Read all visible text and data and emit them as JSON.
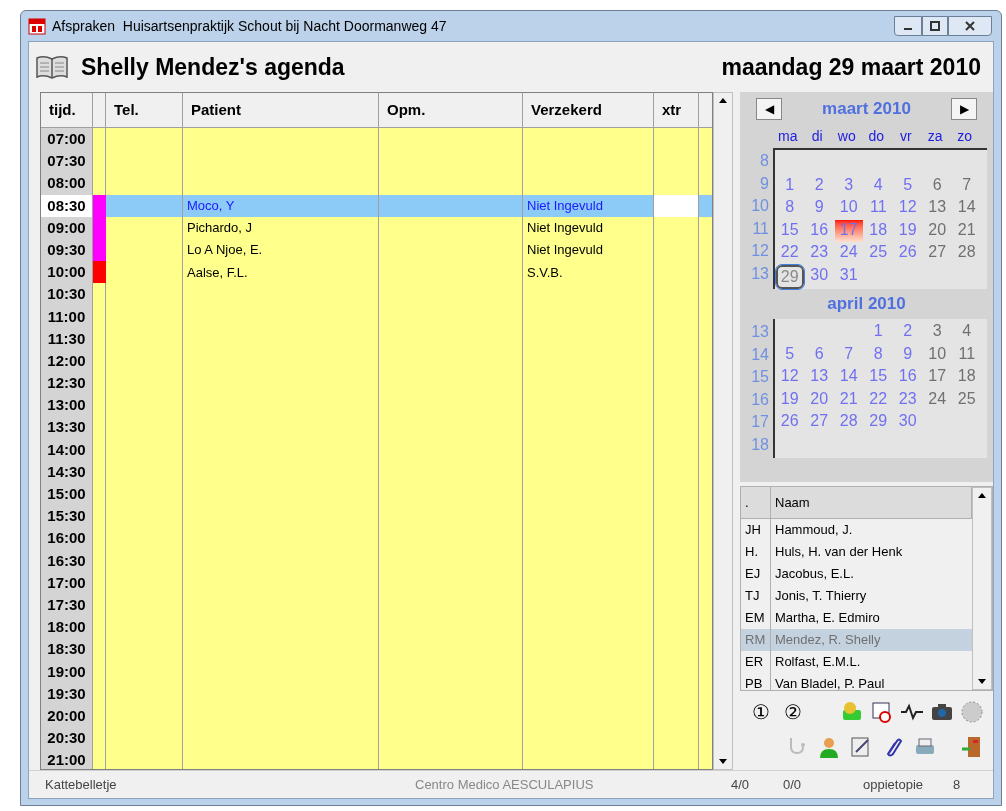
{
  "window": {
    "title": "Afspraken  Huisartsenpraktijk Schout bij Nacht Doormanweg 47"
  },
  "header": {
    "agenda_title": "Shelly Mendez's agenda",
    "date": "maandag 29 maart 2010"
  },
  "table": {
    "columns": [
      "tijd.",
      "Tel.",
      "Patient",
      "Opm.",
      "Verzekerd",
      "xtr"
    ],
    "rows": [
      {
        "time": "07:00",
        "selected": false
      },
      {
        "time": "07:30",
        "selected": false
      },
      {
        "time": "08:00",
        "selected": false
      },
      {
        "time": "08:30",
        "selected": true,
        "color": "#ff00ff",
        "patient": "Moco,  Y",
        "insured": "Niet Ingevuld"
      },
      {
        "time": "09:00",
        "selected": false,
        "color": "#ff00ff",
        "patient": "Pichardo,  J",
        "insured": "Niet Ingevuld"
      },
      {
        "time": "09:30",
        "selected": false,
        "color": "#ff00ff",
        "patient": "Lo A Njoe,  E.",
        "insured": "Niet Ingevuld"
      },
      {
        "time": "10:00",
        "selected": false,
        "color": "#ff0000",
        "patient": "Aalse,  F.L.",
        "insured": "S.V.B."
      },
      {
        "time": "10:30",
        "selected": false
      },
      {
        "time": "11:00",
        "selected": false
      },
      {
        "time": "11:30",
        "selected": false
      },
      {
        "time": "12:00",
        "selected": false
      },
      {
        "time": "12:30",
        "selected": false
      },
      {
        "time": "13:00",
        "selected": false
      },
      {
        "time": "13:30",
        "selected": false
      },
      {
        "time": "14:00",
        "selected": false
      },
      {
        "time": "14:30",
        "selected": false
      },
      {
        "time": "15:00",
        "selected": false
      },
      {
        "time": "15:30",
        "selected": false
      },
      {
        "time": "16:00",
        "selected": false
      },
      {
        "time": "16:30",
        "selected": false
      },
      {
        "time": "17:00",
        "selected": false
      },
      {
        "time": "17:30",
        "selected": false
      },
      {
        "time": "18:00",
        "selected": false
      },
      {
        "time": "18:30",
        "selected": false
      },
      {
        "time": "19:00",
        "selected": false
      },
      {
        "time": "19:30",
        "selected": false
      },
      {
        "time": "20:00",
        "selected": false
      },
      {
        "time": "20:30",
        "selected": false
      },
      {
        "time": "21:00",
        "selected": false
      }
    ]
  },
  "calendar": {
    "prev": "◀",
    "next": "▶",
    "weekdays": [
      "ma",
      "di",
      "wo",
      "do",
      "vr",
      "za",
      "zo"
    ],
    "months": [
      {
        "title": "maart 2010",
        "weeks": [
          {
            "week": "8",
            "kind": "left"
          },
          {
            "week": "9",
            "kind": "left",
            "days": [
              {
                "day": "1",
                "kind": "weekday",
                "selected": false
              },
              {
                "day": "2",
                "kind": "weekday",
                "selected": false
              },
              {
                "day": "3",
                "kind": "weekday",
                "selected": false
              },
              {
                "day": "4",
                "kind": "weekday",
                "selected": false
              },
              {
                "day": "5",
                "kind": "weekday",
                "selected": false
              },
              {
                "day": "6",
                "kind": "weekend",
                "selected": false
              },
              {
                "day": "7",
                "kind": "weekend",
                "selected": false
              }
            ]
          },
          {
            "week": "10",
            "kind": "left",
            "days": [
              {
                "day": "8",
                "kind": "weekday",
                "selected": false
              },
              {
                "day": "9",
                "kind": "weekday",
                "selected": false
              },
              {
                "day": "10",
                "kind": "weekday",
                "selected": false
              },
              {
                "day": "11",
                "kind": "weekday",
                "selected": false
              },
              {
                "day": "12",
                "kind": "weekday",
                "selected": false
              },
              {
                "day": "13",
                "kind": "weekend",
                "selected": false
              },
              {
                "day": "14",
                "kind": "weekend",
                "selected": false
              }
            ]
          },
          {
            "week": "11",
            "kind": "left",
            "days": [
              {
                "day": "15",
                "kind": "weekday",
                "selected": false
              },
              {
                "day": "16",
                "kind": "weekday",
                "selected": false
              },
              {
                "day": "17",
                "kind": "marked",
                "selected": false
              },
              {
                "day": "18",
                "kind": "weekday",
                "selected": false
              },
              {
                "day": "19",
                "kind": "weekday",
                "selected": false
              },
              {
                "day": "20",
                "kind": "weekend",
                "selected": false
              },
              {
                "day": "21",
                "kind": "weekend",
                "selected": false
              }
            ]
          },
          {
            "week": "12",
            "kind": "left",
            "days": [
              {
                "day": "22",
                "kind": "weekday",
                "selected": false
              },
              {
                "day": "23",
                "kind": "weekday",
                "selected": false
              },
              {
                "day": "24",
                "kind": "weekday",
                "selected": false
              },
              {
                "day": "25",
                "kind": "weekday",
                "selected": false
              },
              {
                "day": "26",
                "kind": "weekday",
                "selected": false
              },
              {
                "day": "27",
                "kind": "weekend",
                "selected": false
              },
              {
                "day": "28",
                "kind": "weekend",
                "selected": false
              }
            ]
          },
          {
            "week": "13",
            "kind": "left",
            "days": [
              {
                "day": "29",
                "kind": "weekday",
                "selected": true
              },
              {
                "day": "30",
                "kind": "weekday",
                "selected": false
              },
              {
                "day": "31",
                "kind": "weekday",
                "selected": false
              }
            ]
          }
        ]
      },
      {
        "title": "april 2010",
        "weeks": [
          {
            "week": "13",
            "kind": "right",
            "days": [
              {
                "day": "1",
                "kind": "weekday",
                "selected": false
              },
              {
                "day": "2",
                "kind": "weekday",
                "selected": false
              },
              {
                "day": "3",
                "kind": "weekend",
                "selected": false
              },
              {
                "day": "4",
                "kind": "weekend",
                "selected": false
              }
            ]
          },
          {
            "week": "14",
            "kind": "left",
            "days": [
              {
                "day": "5",
                "kind": "weekday",
                "selected": false
              },
              {
                "day": "6",
                "kind": "weekday",
                "selected": false
              },
              {
                "day": "7",
                "kind": "weekday",
                "selected": false
              },
              {
                "day": "8",
                "kind": "weekday",
                "selected": false
              },
              {
                "day": "9",
                "kind": "weekday",
                "selected": false
              },
              {
                "day": "10",
                "kind": "weekend",
                "selected": false
              },
              {
                "day": "11",
                "kind": "weekend",
                "selected": false
              }
            ]
          },
          {
            "week": "15",
            "kind": "left",
            "days": [
              {
                "day": "12",
                "kind": "weekday",
                "selected": false
              },
              {
                "day": "13",
                "kind": "weekday",
                "selected": false
              },
              {
                "day": "14",
                "kind": "weekday",
                "selected": false
              },
              {
                "day": "15",
                "kind": "weekday",
                "selected": false
              },
              {
                "day": "16",
                "kind": "weekday",
                "selected": false
              },
              {
                "day": "17",
                "kind": "weekend",
                "selected": false
              },
              {
                "day": "18",
                "kind": "weekend",
                "selected": false
              }
            ]
          },
          {
            "week": "16",
            "kind": "left",
            "days": [
              {
                "day": "19",
                "kind": "weekday",
                "selected": false
              },
              {
                "day": "20",
                "kind": "weekday",
                "selected": false
              },
              {
                "day": "21",
                "kind": "weekday",
                "selected": false
              },
              {
                "day": "22",
                "kind": "weekday",
                "selected": false
              },
              {
                "day": "23",
                "kind": "weekday",
                "selected": false
              },
              {
                "day": "24",
                "kind": "weekend",
                "selected": false
              },
              {
                "day": "25",
                "kind": "weekend",
                "selected": false
              }
            ]
          },
          {
            "week": "17",
            "kind": "left",
            "days": [
              {
                "day": "26",
                "kind": "weekday",
                "selected": false
              },
              {
                "day": "27",
                "kind": "weekday",
                "selected": false
              },
              {
                "day": "28",
                "kind": "weekday",
                "selected": false
              },
              {
                "day": "29",
                "kind": "weekday",
                "selected": false
              },
              {
                "day": "30",
                "kind": "weekday",
                "selected": false
              }
            ]
          },
          {
            "week": "18",
            "kind": "left"
          }
        ]
      }
    ]
  },
  "doctors": {
    "columns": [
      ".",
      "Naam"
    ],
    "rows": [
      {
        "code": "JH",
        "name": "Hammoud, J.",
        "selected": false
      },
      {
        "code": "H.",
        "name": "Huls, H. van der Henk",
        "selected": false
      },
      {
        "code": "EJ",
        "name": "Jacobus, E.L.",
        "selected": false
      },
      {
        "code": "TJ",
        "name": "Jonis, T.  Thierry",
        "selected": false
      },
      {
        "code": "EM",
        "name": "Martha, E.  Edmiro",
        "selected": false
      },
      {
        "code": "RM",
        "name": "Mendez, R.  Shelly",
        "selected": true
      },
      {
        "code": "ER",
        "name": "Rolfast, E.M.L.",
        "selected": false
      },
      {
        "code": "PB",
        "name": "Van Bladel, P.  Paul",
        "selected": false
      }
    ]
  },
  "toolbar": {
    "view_buttons": [
      "①",
      "②"
    ]
  },
  "status_bar": {
    "note": "Kattebelletje",
    "practice": "Centro Medico AESCULAPIUS",
    "count_1": "4/0",
    "count_2": "0/0",
    "user": "oppietopie",
    "number": "8"
  }
}
